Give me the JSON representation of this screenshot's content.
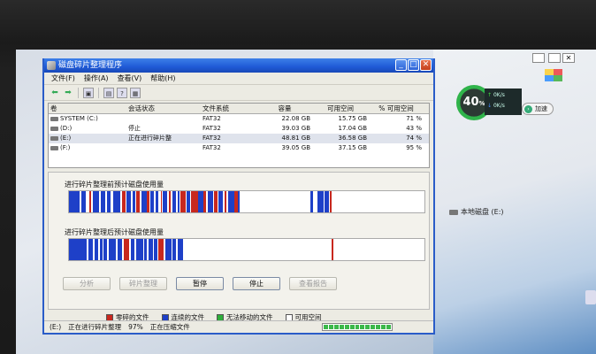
{
  "window": {
    "title": "磁盘碎片整理程序",
    "minimize": "_",
    "maximize": "□",
    "close": "✕"
  },
  "menu": [
    "文件(F)",
    "操作(A)",
    "查看(V)",
    "帮助(H)"
  ],
  "table": {
    "columns": [
      "卷",
      "会话状态",
      "文件系统",
      "容量",
      "可用空间",
      "% 可用空间"
    ],
    "rows": [
      {
        "volume": "SYSTEM (C:)",
        "status": "",
        "fs": "FAT32",
        "capacity": "22.08 GB",
        "free": "15.75 GB",
        "pct": "71 %"
      },
      {
        "volume": "(D:)",
        "status": "停止",
        "fs": "FAT32",
        "capacity": "39.03 GB",
        "free": "17.04 GB",
        "pct": "43 %"
      },
      {
        "volume": "(E:)",
        "status": "正在进行碎片整",
        "fs": "FAT32",
        "capacity": "48.81 GB",
        "free": "36.58 GB",
        "pct": "74 %"
      },
      {
        "volume": "(F:)",
        "status": "",
        "fs": "FAT32",
        "capacity": "39.05 GB",
        "free": "37.15 GB",
        "pct": "95 %"
      }
    ]
  },
  "panel": {
    "before_label": "进行碎片整理前预计磁盘使用量",
    "after_label": "进行碎片整理后预计磁盘使用量",
    "buttons": {
      "analyze": "分析",
      "defrag": "碎片整理",
      "pause": "暂停",
      "stop": "停止",
      "report": "查看报告"
    }
  },
  "legend": [
    {
      "label": "零碎的文件",
      "color": "#c8281e"
    },
    {
      "label": "连续的文件",
      "color": "#1e40c8"
    },
    {
      "label": "无法移动的文件",
      "color": "#2eae3a"
    },
    {
      "label": "可用空间",
      "color": "#ffffff"
    }
  ],
  "status": {
    "drive": "(E:)",
    "state": "正在进行碎片整理",
    "percent": "97%",
    "detail": "正在压缩文件"
  },
  "desktop": {
    "gauge_value": "40",
    "gauge_unit": "%",
    "net_up": "0K/s",
    "net_down": "0K/s",
    "speed_button": "加速",
    "local_disk": "本地磁盘 (E:)"
  },
  "colors": {
    "fragmented": "#c8281e",
    "contiguous": "#1e40c8",
    "unmovable": "#2eae3a",
    "free": "#ffffff"
  }
}
